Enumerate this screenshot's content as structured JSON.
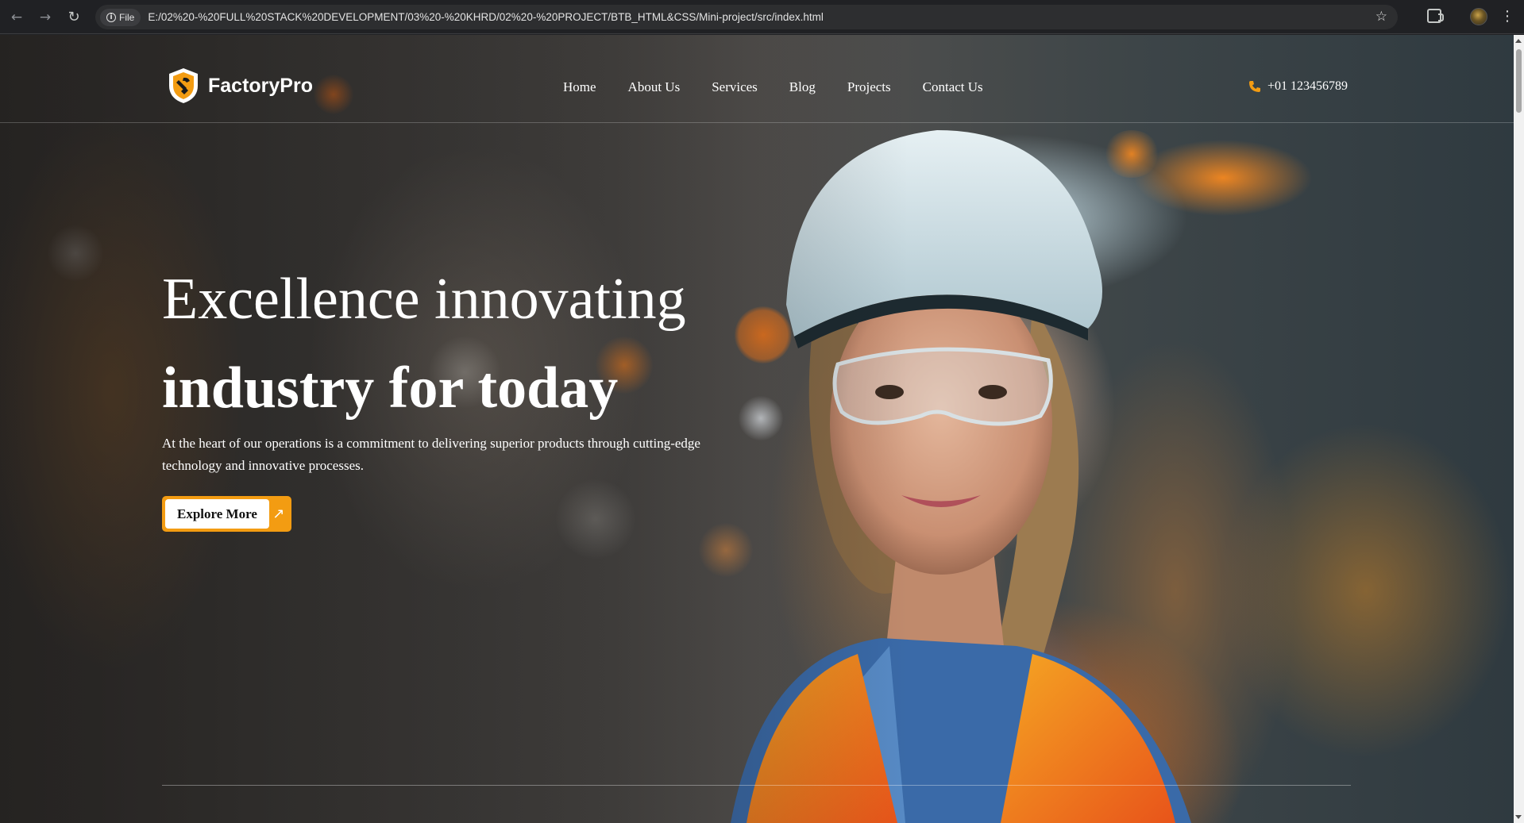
{
  "browser": {
    "file_chip": "File",
    "url": "E:/02%20-%20FULL%20STACK%20DEVELOPMENT/03%20-%20KHRD/02%20-%20PROJECT/BTB_HTML&CSS/Mini-project/src/index.html",
    "icons": [
      "back-arrow-icon",
      "forward-arrow-icon",
      "reload-icon",
      "info-icon",
      "star-icon",
      "extensions-icon",
      "profile-avatar",
      "menu-dots-icon"
    ]
  },
  "header": {
    "logo_text": "FactoryPro",
    "nav": [
      "Home",
      "About Us",
      "Services",
      "Blog",
      "Projects",
      "Contact Us"
    ],
    "phone": "+01 123456789",
    "accent_color": "#f39c12"
  },
  "hero": {
    "title_line1": "Excellence innovating",
    "title_line2": "industry for today",
    "description": "At the heart of our operations is a commitment to delivering superior products through cutting-edge technology and innovative processes.",
    "button_label": "Explore More",
    "button_icon": "arrow-up-right-icon"
  }
}
